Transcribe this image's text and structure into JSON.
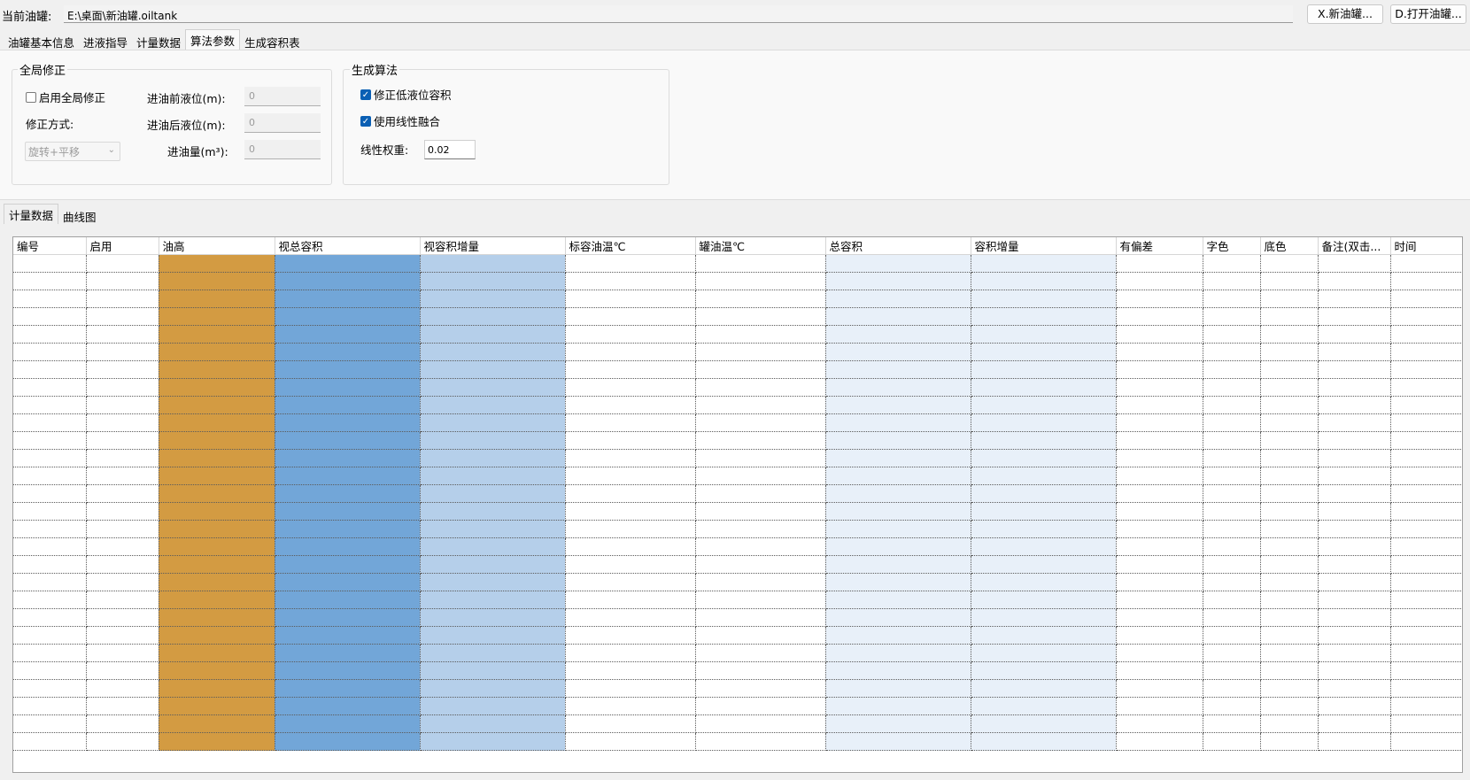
{
  "topbar": {
    "label": "当前油罐:",
    "path": "E:\\桌面\\新油罐.oiltank",
    "new_button": "X.新油罐...",
    "open_button": "D.打开油罐..."
  },
  "main_tabs": [
    "油罐基本信息",
    "进液指导",
    "计量数据",
    "算法参数",
    "生成容积表"
  ],
  "active_main_tab": "算法参数",
  "global_correction": {
    "title": "全局修正",
    "enable_label": "启用全局修正",
    "enabled": false,
    "method_label": "修正方式:",
    "method_value": "旋转+平移",
    "before_level_label": "进油前液位(m):",
    "before_level_value": "0",
    "after_level_label": "进油后液位(m):",
    "after_level_value": "0",
    "volume_label": "进油量(m³):",
    "volume_value": "0"
  },
  "generation": {
    "title": "生成算法",
    "fix_low_label": "修正低液位容积",
    "fix_low_checked": true,
    "linear_fusion_label": "使用线性融合",
    "linear_fusion_checked": true,
    "weight_label": "线性权重:",
    "weight_value": "0.02"
  },
  "sub_tabs": [
    "计量数据",
    "曲线图"
  ],
  "active_sub_tab": "计量数据",
  "table": {
    "columns": [
      "编号",
      "启用",
      "油高",
      "视总容积",
      "视容积增量",
      "标容油温℃",
      "罐油温℃",
      "总容积",
      "容积增量",
      "有偏差",
      "字色",
      "底色",
      "备注(双击...",
      "时间"
    ],
    "column_colors": [
      "#ffffff",
      "#ffffff",
      "#d39b42",
      "#72a6d8",
      "#b5cfea",
      "#ffffff",
      "#ffffff",
      "#e8f0f9",
      "#e8f0f9",
      "#ffffff",
      "#ffffff",
      "#ffffff",
      "#ffffff",
      "#ffffff"
    ],
    "row_count": 28
  }
}
